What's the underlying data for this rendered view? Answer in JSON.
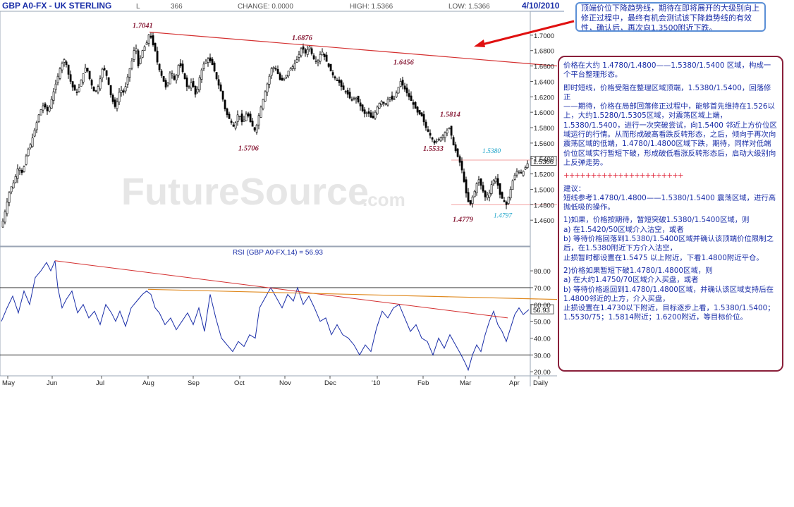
{
  "header": {
    "symbol": "GBP A0-FX - UK STERLING",
    "last_label": "L",
    "last_value": "366",
    "change": "CHANGE: 0.0000",
    "high": "HIGH: 1.5366",
    "low": "LOW: 1.5366",
    "date": "4/10/2010"
  },
  "colors": {
    "price": "#000000",
    "rsi": "#1a2ea8",
    "trend_red": "#d43030",
    "trend_orange": "#e08a20",
    "annot_red": "#8a1f3a",
    "annot_cyan": "#1aa3c8"
  },
  "chart_data": [
    {
      "type": "candlestick",
      "title": "GBP A0-FX - UK STERLING",
      "ylim": [
        1.43,
        1.72
      ],
      "y_ticks": [
        "1.7000",
        "1.6800",
        "1.6600",
        "1.6400",
        "1.6200",
        "1.6000",
        "1.5800",
        "1.5600",
        "1.5400",
        "1.5200",
        "1.5000",
        "1.4800",
        "1.4600"
      ],
      "y_tick_values": [
        1.7,
        1.68,
        1.66,
        1.64,
        1.62,
        1.6,
        1.58,
        1.56,
        1.54,
        1.52,
        1.5,
        1.48,
        1.46
      ],
      "x_labels": [
        "May",
        "Jun",
        "Jul",
        "Aug",
        "Sep",
        "Oct",
        "Nov",
        "Dec",
        "'10",
        "Feb",
        "Mar",
        "Apr",
        "Daily"
      ],
      "price_path": [
        [
          0,
          1.451
        ],
        [
          6,
          1.475
        ],
        [
          12,
          1.5
        ],
        [
          18,
          1.51
        ],
        [
          24,
          1.53
        ],
        [
          30,
          1.52
        ],
        [
          36,
          1.548
        ],
        [
          42,
          1.56
        ],
        [
          48,
          1.58
        ],
        [
          54,
          1.6
        ],
        [
          60,
          1.61
        ],
        [
          66,
          1.6
        ],
        [
          72,
          1.62
        ],
        [
          78,
          1.64
        ],
        [
          84,
          1.66
        ],
        [
          90,
          1.67
        ],
        [
          96,
          1.645
        ],
        [
          102,
          1.63
        ],
        [
          108,
          1.625
        ],
        [
          114,
          1.645
        ],
        [
          120,
          1.66
        ],
        [
          126,
          1.64
        ],
        [
          132,
          1.625
        ],
        [
          138,
          1.635
        ],
        [
          144,
          1.66
        ],
        [
          150,
          1.645
        ],
        [
          156,
          1.618
        ],
        [
          162,
          1.605
        ],
        [
          168,
          1.63
        ],
        [
          174,
          1.625
        ],
        [
          180,
          1.65
        ],
        [
          186,
          1.67
        ],
        [
          190,
          1.69
        ],
        [
          194,
          1.66
        ],
        [
          200,
          1.68
        ],
        [
          206,
          1.69
        ],
        [
          210,
          1.704
        ],
        [
          214,
          1.69
        ],
        [
          218,
          1.68
        ],
        [
          222,
          1.66
        ],
        [
          228,
          1.645
        ],
        [
          234,
          1.63
        ],
        [
          240,
          1.655
        ],
        [
          246,
          1.64
        ],
        [
          252,
          1.665
        ],
        [
          258,
          1.65
        ],
        [
          264,
          1.63
        ],
        [
          270,
          1.64
        ],
        [
          276,
          1.62
        ],
        [
          282,
          1.65
        ],
        [
          288,
          1.665
        ],
        [
          294,
          1.67
        ],
        [
          300,
          1.66
        ],
        [
          306,
          1.64
        ],
        [
          312,
          1.625
        ],
        [
          318,
          1.6
        ],
        [
          324,
          1.59
        ],
        [
          330,
          1.58
        ],
        [
          336,
          1.6
        ],
        [
          342,
          1.585
        ],
        [
          348,
          1.6
        ],
        [
          354,
          1.585
        ],
        [
          360,
          1.575
        ],
        [
          366,
          1.6
        ],
        [
          372,
          1.62
        ],
        [
          378,
          1.64
        ],
        [
          384,
          1.66
        ],
        [
          390,
          1.655
        ],
        [
          396,
          1.64
        ],
        [
          402,
          1.645
        ],
        [
          408,
          1.655
        ],
        [
          414,
          1.66
        ],
        [
          420,
          1.67
        ],
        [
          426,
          1.685
        ],
        [
          432,
          1.675
        ],
        [
          436,
          1.688
        ],
        [
          442,
          1.67
        ],
        [
          448,
          1.665
        ],
        [
          454,
          1.68
        ],
        [
          460,
          1.668
        ],
        [
          466,
          1.655
        ],
        [
          472,
          1.645
        ],
        [
          478,
          1.64
        ],
        [
          484,
          1.63
        ],
        [
          490,
          1.625
        ],
        [
          496,
          1.615
        ],
        [
          502,
          1.62
        ],
        [
          508,
          1.61
        ],
        [
          514,
          1.598
        ],
        [
          520,
          1.6
        ],
        [
          526,
          1.59
        ],
        [
          532,
          1.605
        ],
        [
          538,
          1.615
        ],
        [
          544,
          1.61
        ],
        [
          550,
          1.62
        ],
        [
          556,
          1.615
        ],
        [
          562,
          1.63
        ],
        [
          566,
          1.64
        ],
        [
          572,
          1.63
        ],
        [
          578,
          1.62
        ],
        [
          584,
          1.61
        ],
        [
          590,
          1.6
        ],
        [
          596,
          1.595
        ],
        [
          602,
          1.58
        ],
        [
          608,
          1.57
        ],
        [
          614,
          1.56
        ],
        [
          620,
          1.565
        ],
        [
          626,
          1.57
        ],
        [
          630,
          1.575
        ],
        [
          636,
          1.58
        ],
        [
          640,
          1.56
        ],
        [
          646,
          1.545
        ],
        [
          652,
          1.53
        ],
        [
          656,
          1.51
        ],
        [
          660,
          1.49
        ],
        [
          664,
          1.478
        ],
        [
          668,
          1.49
        ],
        [
          672,
          1.5
        ],
        [
          676,
          1.515
        ],
        [
          680,
          1.505
        ],
        [
          686,
          1.49
        ],
        [
          692,
          1.495
        ],
        [
          696,
          1.51
        ],
        [
          702,
          1.515
        ],
        [
          706,
          1.495
        ],
        [
          712,
          1.485
        ],
        [
          716,
          1.48
        ],
        [
          722,
          1.5
        ],
        [
          726,
          1.515
        ],
        [
          732,
          1.525
        ],
        [
          738,
          1.52
        ],
        [
          744,
          1.53
        ],
        [
          748,
          1.5366
        ]
      ],
      "annotations_red": [
        {
          "text": "1.7041",
          "x": 210,
          "y": 1.704
        },
        {
          "text": "1.6876",
          "x": 436,
          "y": 1.688
        },
        {
          "text": "1.6456",
          "x": 566,
          "y": 1.6456
        },
        {
          "text": "1.5814",
          "x": 636,
          "y": 1.5814
        },
        {
          "text": "1.5706",
          "x": 360,
          "y": 1.5706
        },
        {
          "text": "1.5533",
          "x": 652,
          "y": 1.5533
        },
        {
          "text": "1.4779",
          "x": 664,
          "y": 1.4779
        }
      ],
      "annotations_cyan": [
        {
          "text": "1.5380",
          "x": 700,
          "y": 1.538
        },
        {
          "text": "1.4797",
          "x": 716,
          "y": 1.4797
        }
      ],
      "trendline": [
        [
          210,
          1.704
        ],
        [
          790,
          1.66
        ]
      ],
      "hlines": [
        1.538,
        1.48
      ],
      "last_price": "1.5366"
    },
    {
      "type": "line",
      "title": "RSI (GBP A0-FX,14) = 56.93",
      "ylim": [
        18,
        88
      ],
      "y_ticks": [
        "80.00",
        "70.00",
        "60.00",
        "50.00",
        "40.00",
        "30.00",
        "20.00"
      ],
      "y_tick_values": [
        80,
        70,
        60,
        50,
        40,
        30,
        20
      ],
      "reference_lines": [
        70,
        30
      ],
      "last_value": "56.93",
      "rsi_path": [
        [
          0,
          50
        ],
        [
          8,
          58
        ],
        [
          16,
          65
        ],
        [
          24,
          55
        ],
        [
          32,
          68
        ],
        [
          40,
          60
        ],
        [
          48,
          76
        ],
        [
          56,
          80
        ],
        [
          64,
          85
        ],
        [
          70,
          80
        ],
        [
          76,
          86
        ],
        [
          80,
          70
        ],
        [
          86,
          58
        ],
        [
          92,
          63
        ],
        [
          100,
          68
        ],
        [
          108,
          55
        ],
        [
          116,
          60
        ],
        [
          124,
          52
        ],
        [
          132,
          56
        ],
        [
          140,
          48
        ],
        [
          148,
          60
        ],
        [
          156,
          55
        ],
        [
          162,
          50
        ],
        [
          168,
          56
        ],
        [
          176,
          47
        ],
        [
          184,
          58
        ],
        [
          192,
          62
        ],
        [
          200,
          66
        ],
        [
          206,
          68
        ],
        [
          212,
          66
        ],
        [
          218,
          58
        ],
        [
          224,
          55
        ],
        [
          232,
          48
        ],
        [
          240,
          52
        ],
        [
          248,
          45
        ],
        [
          256,
          50
        ],
        [
          264,
          55
        ],
        [
          272,
          48
        ],
        [
          280,
          58
        ],
        [
          288,
          44
        ],
        [
          296,
          66
        ],
        [
          304,
          52
        ],
        [
          312,
          40
        ],
        [
          320,
          36
        ],
        [
          328,
          32
        ],
        [
          336,
          38
        ],
        [
          344,
          35
        ],
        [
          352,
          42
        ],
        [
          360,
          40
        ],
        [
          366,
          58
        ],
        [
          374,
          64
        ],
        [
          382,
          70
        ],
        [
          390,
          64
        ],
        [
          398,
          58
        ],
        [
          406,
          66
        ],
        [
          414,
          62
        ],
        [
          420,
          70
        ],
        [
          428,
          60
        ],
        [
          436,
          65
        ],
        [
          444,
          58
        ],
        [
          452,
          50
        ],
        [
          460,
          52
        ],
        [
          468,
          42
        ],
        [
          476,
          48
        ],
        [
          484,
          42
        ],
        [
          492,
          40
        ],
        [
          500,
          36
        ],
        [
          508,
          30
        ],
        [
          516,
          36
        ],
        [
          524,
          32
        ],
        [
          532,
          46
        ],
        [
          540,
          56
        ],
        [
          548,
          52
        ],
        [
          556,
          58
        ],
        [
          564,
          60
        ],
        [
          572,
          52
        ],
        [
          580,
          44
        ],
        [
          588,
          48
        ],
        [
          596,
          40
        ],
        [
          604,
          38
        ],
        [
          612,
          30
        ],
        [
          620,
          40
        ],
        [
          628,
          34
        ],
        [
          636,
          42
        ],
        [
          644,
          36
        ],
        [
          652,
          30
        ],
        [
          658,
          25
        ],
        [
          662,
          21
        ],
        [
          668,
          30
        ],
        [
          674,
          36
        ],
        [
          680,
          32
        ],
        [
          686,
          42
        ],
        [
          692,
          50
        ],
        [
          698,
          56
        ],
        [
          704,
          48
        ],
        [
          710,
          44
        ],
        [
          716,
          38
        ],
        [
          722,
          46
        ],
        [
          728,
          54
        ],
        [
          734,
          58
        ],
        [
          740,
          54
        ],
        [
          748,
          56.93
        ]
      ],
      "trendline_red": [
        [
          76,
          86
        ],
        [
          720,
          52
        ]
      ],
      "trendline_orange": [
        [
          210,
          69
        ],
        [
          790,
          63
        ]
      ]
    }
  ],
  "callout_top": {
    "text": "顶端价位下降趋势线，期待在即将展开的大级别向上修正过程中，最终有机会测试该下降趋势线的有效性，确认后，再次向1.3500附近下跌。"
  },
  "notes": {
    "p1": "价格在大约 1.4780/1.4800——1.5380/1.5400 区域，构成一个平台整理形态。",
    "p2": "即时短线，价格受阻在整理区域顶端，1.5380/1.5400，回落修正",
    "p3": "——期待，价格在局部回落修正过程中，能够首先维持在1.526以上，大约1.5280/1.5305区域，对震荡区域上端，1.5380/1.5400，进行一次突破尝试，向1.5400 邻近上方价位区域运行的行情。从而形成破高看跌反转形态，之后，倾向于再次向震荡区域的低端，1.4780/1.4800区域下跌，期待，同样对低端价位区域实行暂短下破，形成破低看涨反转形态后，启动大级别向上反弹走势。",
    "sep": "++++++++++++++++++++++",
    "p4": "建议：",
    "p5": "短线参考1.4780/1.4800——1.5380/1.5400 震荡区域，进行高抛低吸的操作。",
    "p6": "1)如果，价格按期待，暂短突破1.5380/1.5400区域，则",
    "p7": "a) 在1.5420/50区域介入沽空，或者",
    "p8": "b) 等待价格回落到1.5380/1.5400区域并确认该顶端价位限制之后，在1.5380附近下方介入沽空，",
    "p9": "止损暂时都设置在1.5475 以上附近，下看1.4800附近平仓。",
    "p10": "2)价格如果暂短下破1.4780/1.4800区域，则",
    "p11": "a) 在大约1.4750/70区域介入买盘，或者",
    "p12": "b) 等待价格返回到1.4780/1.4800区域，并确认该区域支持后在1.4800邻近的上方，介入买盘，",
    "p13": "止损设置在1.4730以下附近，目标逐步上看，1.5380/1.5400；1.5530/75；1.5814附近；1.6200附近，等目标价位。"
  },
  "watermark": {
    "main": "FutureSource",
    "suffix": ".com"
  }
}
